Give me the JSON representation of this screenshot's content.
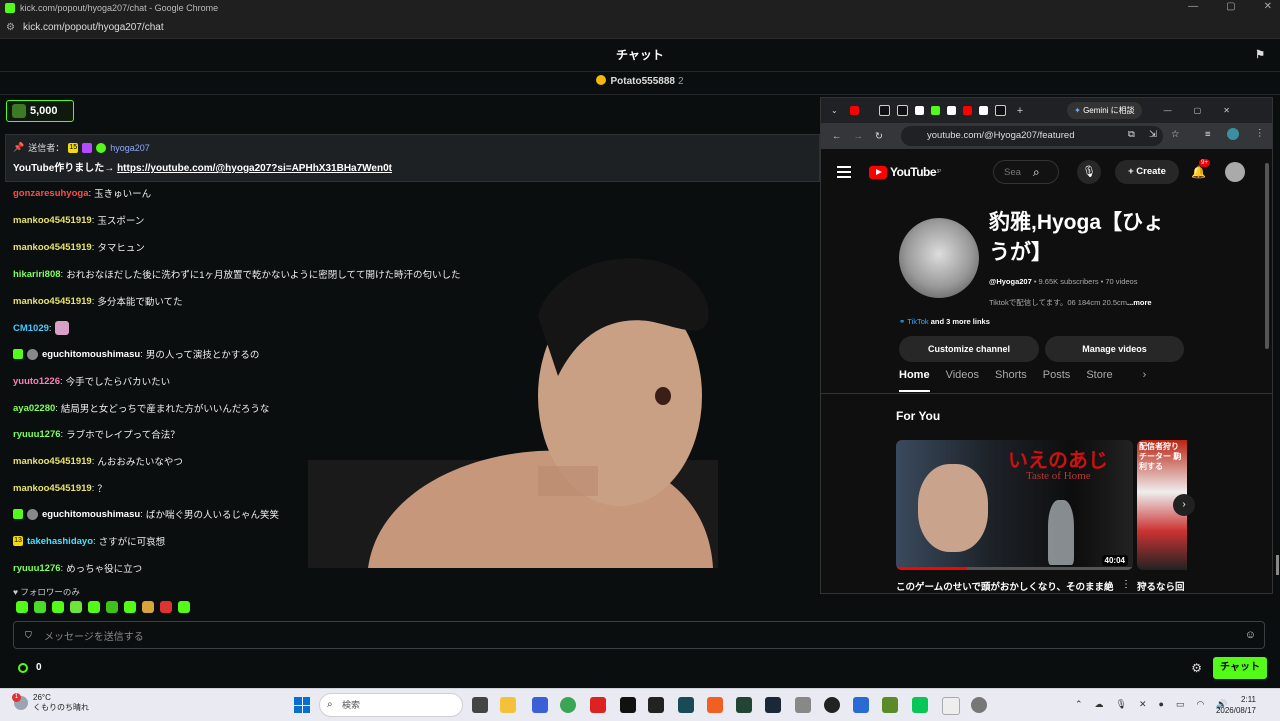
{
  "browser": {
    "window_title": "kick.com/popout/hyoga207/chat - Google Chrome",
    "url": "kick.com/popout/hyoga207/chat"
  },
  "chat": {
    "header_title": "チャット",
    "gifter_name": "Potato555888",
    "gifter_count": "2",
    "balance": "5,000",
    "pinned": {
      "label": "送信者：",
      "badge_num": "15",
      "user": "hyoga207",
      "text": "YouTube作りました→ ",
      "link": "https://youtube.com/@hyoga207?si=APHhX31BHa7Wen0t"
    },
    "messages": [
      {
        "user": "gonzaresuhyoga",
        "color": "#ff4b4b",
        "text": "玉きゅいーん"
      },
      {
        "user": "mankoo45451919",
        "color": "#e8e36a",
        "text": "玉スポーン"
      },
      {
        "user": "mankoo45451919",
        "color": "#e8e36a",
        "text": "タマヒュン"
      },
      {
        "user": "hikariri808",
        "color": "#7fff5b",
        "text": "おれおなほだした後に洗わずに1ヶ月放置で乾かないように密閉してて開けた時汗の匂いした"
      },
      {
        "user": "mankoo45451919",
        "color": "#e8e36a",
        "text": "多分本能で動いてた"
      },
      {
        "user": "CM1029",
        "color": "#48c8ff",
        "text": ""
      },
      {
        "user": "eguchitomoushimasu",
        "color": "#ffffff",
        "text": "男の人って演技とかするの"
      },
      {
        "user": "yuuto1226",
        "color": "#ff7fb5",
        "text": "今手でしたらバカいたい"
      },
      {
        "user": "aya02280",
        "color": "#7fff5b",
        "text": "結局男と女どっちで産まれた方がいいんだろうな"
      },
      {
        "user": "ryuuu1276",
        "color": "#7fff5b",
        "text": "ラブホでレイプって合法？"
      },
      {
        "user": "mankoo45451919",
        "color": "#e8e36a",
        "text": "んおおみたいなやつ"
      },
      {
        "user": "mankoo45451919",
        "color": "#e8e36a",
        "text": "？"
      },
      {
        "user": "eguchitomoushimasu",
        "color": "#ffffff",
        "text": "ばか喘ぐ男の人いるじゃん笑笑"
      },
      {
        "user": "takehashidayo",
        "color": "#48e0ff",
        "text": "さすがに可哀想",
        "badge": "13"
      },
      {
        "user": "ryuuu1276",
        "color": "#7fff5b",
        "text": "めっちゃ役に立つ"
      }
    ],
    "follower_only": "フォロワーのみ",
    "input_placeholder": "メッセージを送信する",
    "points": "0",
    "send_label": "チャット"
  },
  "youtube": {
    "gemini_tab": "Gemini に相談",
    "url": "youtube.com/@Hyoga207/featured",
    "logo": "YouTube",
    "logo_region": "JP",
    "search_placeholder": "Sea",
    "create_label": "Create",
    "bell_count": "9+",
    "channel_name": "豹雅,Hyoga【ひょうが】",
    "handle": "@Hyoga207",
    "meta": " • 9.65K subscribers • 70 videos",
    "description": "Tiktokで配信してます。06 184cm 20.5cm",
    "description_more": "...more",
    "link_tiktok": "TikTok",
    "link_more": " and 3 more links",
    "customize_label": "Customize channel",
    "manage_label": "Manage videos",
    "tabs": [
      "Home",
      "Videos",
      "Shorts",
      "Posts",
      "Store"
    ],
    "section_title": "For You",
    "thumb1_jp": "いえのあじ",
    "thumb1_en": "Taste of Home",
    "thumb1_duration": "40:04",
    "thumb2_text": "配信者狩り チーター 駒利する",
    "video1_title": "このゲームのせいで頭がおかしくなり、そのまま絶",
    "video2_title": "狩るなら回"
  },
  "taskbar": {
    "weather_temp": "26°C",
    "weather_text": "くもりのち晴れ",
    "weather_badge": "1",
    "search_label": "検索",
    "time": "2:11",
    "date": "2026/08/17"
  }
}
